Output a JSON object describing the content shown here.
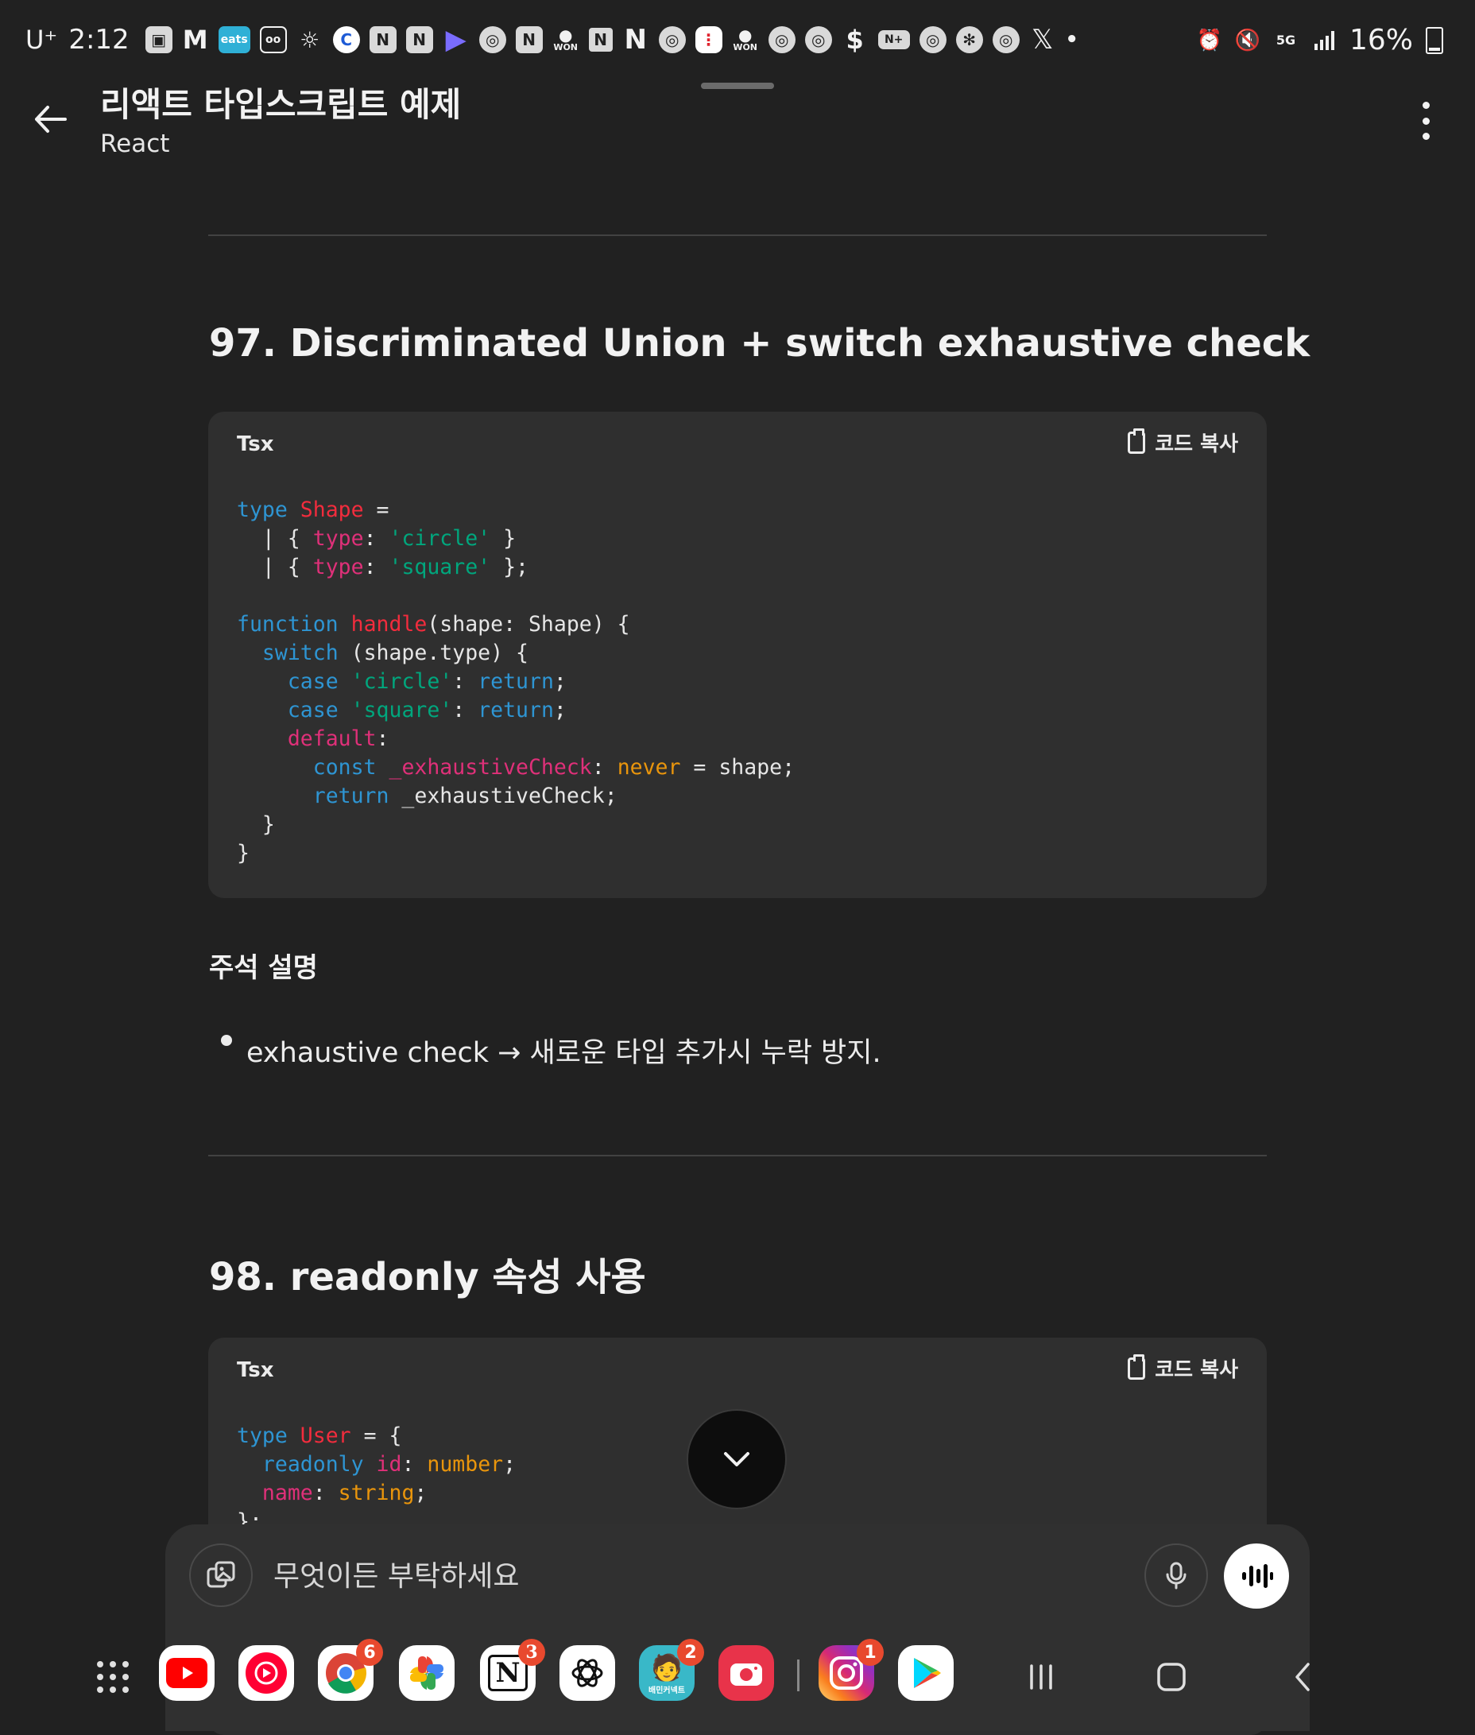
{
  "status_bar": {
    "carrier": "U⁺",
    "time": "2:12",
    "notification_icons": [
      "image-icon",
      "gmail-icon",
      "eats-icon",
      "drive-mode-icon",
      "brightness-icon",
      "coupang-icon",
      "naver-icon",
      "naver-icon",
      "play-icon",
      "chrome-icon",
      "naver-icon",
      "won-chat-icon",
      "naver-news-icon",
      "notion-icon",
      "chrome-icon",
      "chat-red-icon",
      "won-chat-icon",
      "chrome-icon",
      "chrome-icon",
      "s-pay-icon",
      "nplus-icon",
      "chrome-icon",
      "openai-icon",
      "chrome-icon",
      "x-icon",
      "more-dot-icon"
    ],
    "eats_label": "eats",
    "won_label": "WON",
    "nplus_label": "N+",
    "battery": "16%",
    "network": "5G"
  },
  "header": {
    "title": "리액트 타입스크립트 예제",
    "subtitle": "React"
  },
  "sections": [
    {
      "title": "97. Discriminated Union + switch exhaustive check",
      "code": {
        "language": "Tsx",
        "copy_label": "코드 복사",
        "lines": [
          "type Shape =",
          "  | { type: 'circle' }",
          "  | { type: 'square' };",
          "",
          "function handle(shape: Shape) {",
          "  switch (shape.type) {",
          "    case 'circle': return;",
          "    case 'square': return;",
          "    default:",
          "      const _exhaustiveCheck: never = shape;",
          "      return _exhaustiveCheck;",
          "  }",
          "}"
        ]
      },
      "notes_heading": "주석 설명",
      "notes": [
        "exhaustive check → 새로운 타입 추가시 누락 방지."
      ]
    },
    {
      "title": "98. readonly 속성 사용",
      "code": {
        "language": "Tsx",
        "copy_label": "코드 복사",
        "lines": [
          "type User = {",
          "  readonly id: number;",
          "  name: string;",
          "};"
        ]
      }
    }
  ],
  "composer": {
    "placeholder": "무엇이든 부탁하세요"
  },
  "dock": {
    "apps": [
      {
        "name": "YouTube",
        "icon": "youtube-icon",
        "color": "#ff0000",
        "badge": ""
      },
      {
        "name": "YouTube Music",
        "icon": "youtube-music-icon",
        "color": "#ff0033",
        "badge": ""
      },
      {
        "name": "Chrome",
        "icon": "chrome-icon",
        "color": "#ffffff",
        "badge": "6"
      },
      {
        "name": "Google Photos",
        "icon": "photos-icon",
        "color": "#ffffff",
        "badge": ""
      },
      {
        "name": "Notion",
        "icon": "notion-icon",
        "color": "#ffffff",
        "badge": "3"
      },
      {
        "name": "ChatGPT",
        "icon": "chatgpt-icon",
        "color": "#ffffff",
        "badge": ""
      },
      {
        "name": "배민커넥트",
        "icon": "baemin-connect-icon",
        "color": "#39b8c8",
        "badge": "2"
      },
      {
        "name": "Camera",
        "icon": "camera-icon",
        "color": "#e8334a",
        "badge": ""
      },
      {
        "name": "Instagram",
        "icon": "instagram-icon",
        "color": "#d62976",
        "badge": "1"
      },
      {
        "name": "Play Store",
        "icon": "play-store-icon",
        "color": "#ffffff",
        "badge": ""
      }
    ],
    "baemin_label": "배민커넥트"
  },
  "colors": {
    "background": "#212121",
    "code_background": "#2f2f2f",
    "keyword": "#2e95d3",
    "type_name": "#f22c3d",
    "property": "#df3079",
    "string": "#00a67d",
    "builtin_type": "#e9950c"
  }
}
